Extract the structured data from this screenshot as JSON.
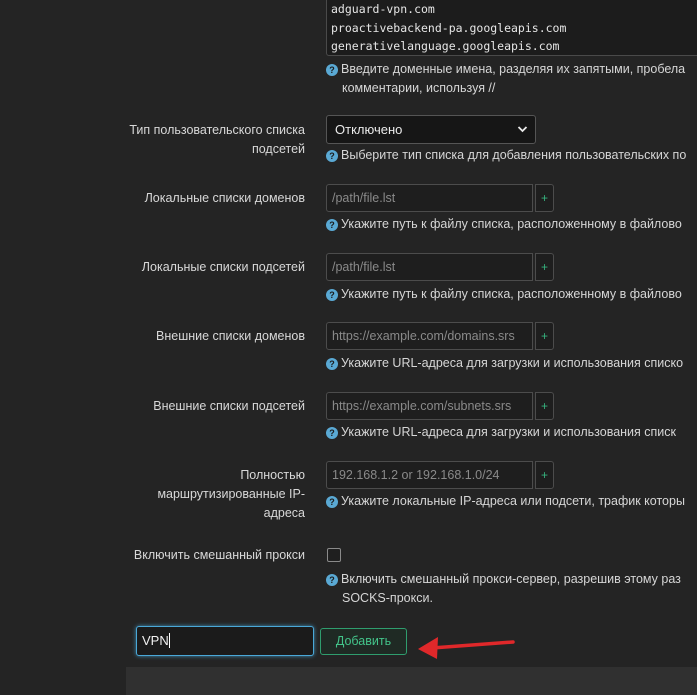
{
  "domains": {
    "lines": [
      "adguard-vpn.com",
      "proactivebackend-pa.googleapis.com",
      "generativelanguage.googleapis.com"
    ],
    "help_line1": "Введите доменные имена, разделяя их запятыми, пробела",
    "help_line2": "комментарии, используя //"
  },
  "subnet_list_type": {
    "label": "Тип пользовательского списка подсетей",
    "value": "Отключено",
    "help": "Выберите тип списка для добавления пользовательских по"
  },
  "local_domain_lists": {
    "label": "Локальные списки доменов",
    "placeholder": "/path/file.lst",
    "help": "Укажите путь к файлу списка, расположенному в файлово"
  },
  "local_subnet_lists": {
    "label": "Локальные списки подсетей",
    "placeholder": "/path/file.lst",
    "help": "Укажите путь к файлу списка, расположенному в файлово"
  },
  "external_domain_lists": {
    "label": "Внешние списки доменов",
    "placeholder": "https://example.com/domains.srs",
    "help": "Укажите URL-адреса для загрузки и использования списко"
  },
  "external_subnet_lists": {
    "label": "Внешние списки подсетей",
    "placeholder": "https://example.com/subnets.srs",
    "help": "Укажите URL-адреса для загрузки и использования списк"
  },
  "fully_routed_ips": {
    "label": "Полностью маршрутизированные IP-адреса",
    "placeholder": "192.168.1.2 or 192.168.1.0/24",
    "help": "Укажите локальные IP-адреса или подсети, трафик которы"
  },
  "mixed_proxy": {
    "label": "Включить смешанный прокси",
    "checked": false,
    "help_line1": "Включить смешанный прокси-сервер, разрешив этому раз",
    "help_line2": "SOCKS-прокси."
  },
  "new_section": {
    "input_value": "VPN",
    "add_label": "Добавить"
  },
  "plus_symbol": "+",
  "help_symbol": "?",
  "colors": {
    "accent": "#36b37e",
    "focus": "#4aa8d8",
    "arrow": "#e0282a"
  }
}
